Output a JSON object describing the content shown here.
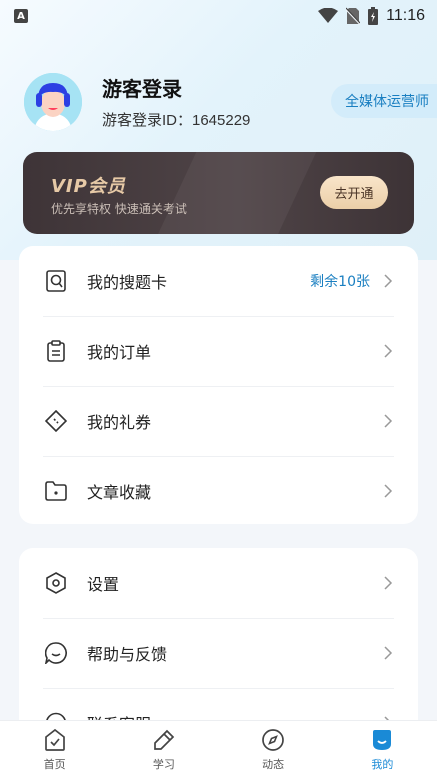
{
  "status_bar": {
    "time": "11:16",
    "app_icon_letter": "A",
    "icons": [
      "wifi-icon",
      "no-sim-icon",
      "battery-icon"
    ]
  },
  "profile": {
    "name": "游客登录",
    "id_text": "游客登录ID：1645229",
    "role_tag": "全媒体运营师"
  },
  "vip": {
    "title": "VIP会员",
    "subtitle": "优先享特权  快速通关考试",
    "button_label": "去开通"
  },
  "menu_group_1": [
    {
      "icon": "question-card-icon",
      "label": "我的搜题卡",
      "extra": "剩余10张"
    },
    {
      "icon": "order-icon",
      "label": "我的订单",
      "extra": ""
    },
    {
      "icon": "coupon-icon",
      "label": "我的礼券",
      "extra": ""
    },
    {
      "icon": "folder-icon",
      "label": "文章收藏",
      "extra": ""
    }
  ],
  "menu_group_2": [
    {
      "icon": "settings-icon",
      "label": "设置"
    },
    {
      "icon": "feedback-icon",
      "label": "帮助与反馈"
    },
    {
      "icon": "contact-icon",
      "label": "联系客服"
    }
  ],
  "tabbar": [
    {
      "icon": "home-icon",
      "label": "首页",
      "active": false
    },
    {
      "icon": "study-icon",
      "label": "学习",
      "active": false
    },
    {
      "icon": "compass-icon",
      "label": "动态",
      "active": false
    },
    {
      "icon": "profile-icon",
      "label": "我的",
      "active": true
    }
  ],
  "colors": {
    "accent": "#1a8ad6",
    "vip_gold": "#e6c9a6",
    "vip_bg": "#463b3e"
  }
}
